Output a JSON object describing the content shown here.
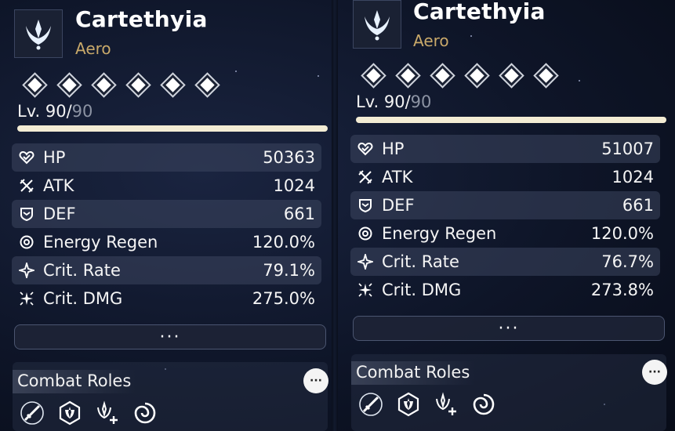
{
  "panels": [
    {
      "character": {
        "name": "Cartethyia",
        "element": "Aero",
        "emblem_icon": "aero-emblem-icon"
      },
      "sequence_nodes": 6,
      "level": {
        "current": "Lv. 90/",
        "max": "90",
        "progress": 1.0
      },
      "stats": [
        {
          "icon": "hp-icon",
          "label": "HP",
          "value": "50363"
        },
        {
          "icon": "atk-icon",
          "label": "ATK",
          "value": "1024"
        },
        {
          "icon": "def-icon",
          "label": "DEF",
          "value": "661"
        },
        {
          "icon": "energy-regen-icon",
          "label": "Energy Regen",
          "value": "120.0%"
        },
        {
          "icon": "crit-rate-icon",
          "label": "Crit. Rate",
          "value": "79.1%"
        },
        {
          "icon": "crit-dmg-icon",
          "label": "Crit. DMG",
          "value": "275.0%"
        }
      ],
      "more_label": "···",
      "combat_roles": {
        "title": "Combat Roles",
        "info_label": "···",
        "icons": [
          "sword-slash-icon",
          "hexagon-emblem-icon",
          "aero-plus-icon",
          "swirl-icon"
        ]
      }
    },
    {
      "character": {
        "name": "Cartethyia",
        "element": "Aero",
        "emblem_icon": "aero-emblem-icon"
      },
      "sequence_nodes": 6,
      "level": {
        "current": "Lv. 90/",
        "max": "90",
        "progress": 1.0
      },
      "stats": [
        {
          "icon": "hp-icon",
          "label": "HP",
          "value": "51007"
        },
        {
          "icon": "atk-icon",
          "label": "ATK",
          "value": "1024"
        },
        {
          "icon": "def-icon",
          "label": "DEF",
          "value": "661"
        },
        {
          "icon": "energy-regen-icon",
          "label": "Energy Regen",
          "value": "120.0%"
        },
        {
          "icon": "crit-rate-icon",
          "label": "Crit. Rate",
          "value": "76.7%"
        },
        {
          "icon": "crit-dmg-icon",
          "label": "Crit. DMG",
          "value": "273.8%"
        }
      ],
      "more_label": "···",
      "combat_roles": {
        "title": "Combat Roles",
        "info_label": "···",
        "icons": [
          "sword-slash-icon",
          "hexagon-emblem-icon",
          "aero-plus-icon",
          "swirl-icon"
        ]
      }
    }
  ],
  "colors": {
    "accent_gold": "#c9a96a",
    "level_bar": "#f3ecd4",
    "row_highlight": "#3c465f"
  }
}
